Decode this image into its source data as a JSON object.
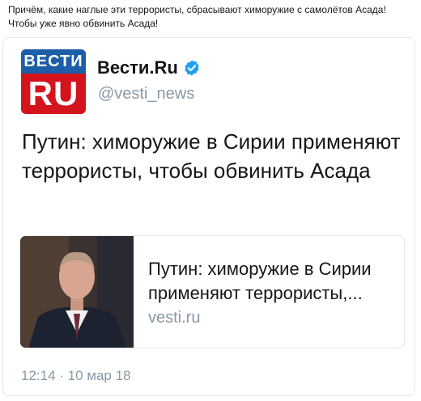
{
  "caption": "Причём, какие наглые эти террористы, сбрасывают химоружие с самолётов Асада! Чтобы уже явно обвинить Асада!",
  "tweet": {
    "avatar": {
      "top_text": "ВЕСТИ",
      "bottom_text": "RU"
    },
    "display_name": "Вести.Ru",
    "handle": "@vesti_news",
    "verified_icon": "verified-badge-icon",
    "text": "Путин: химоружие в Сирии применяют террористы, чтобы обвинить Асада",
    "link_card": {
      "title": "Путин: химоружие в Сирии применяют террористы,...",
      "domain": "vesti.ru",
      "thumbnail": "man-in-suit-interview-image"
    },
    "timestamp": "12:14 · 10 мар 18"
  },
  "colors": {
    "vesti_red": "#d4141c",
    "vesti_blue": "#1d5ea8",
    "verified_blue": "#1da1f2",
    "secondary_text": "#8899a6",
    "border": "#e1e8ed"
  }
}
